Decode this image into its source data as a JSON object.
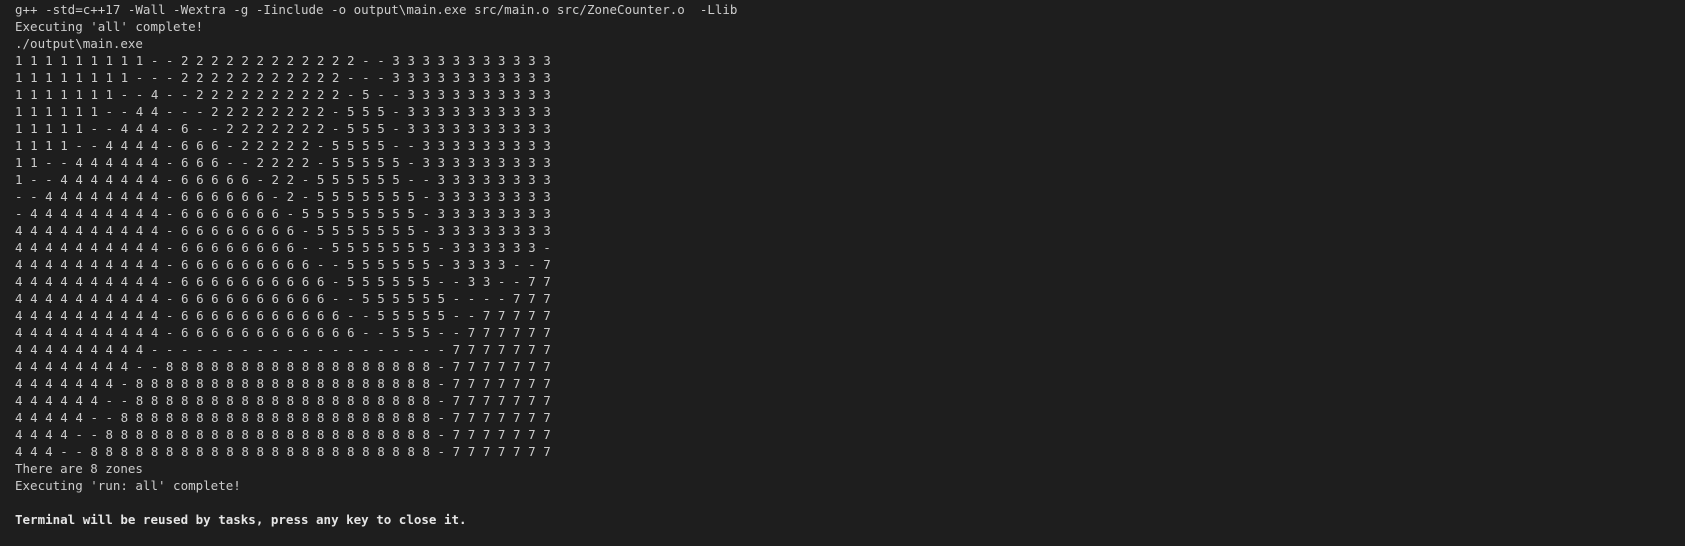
{
  "terminal": {
    "compile_command": "g++ -std=c++17 -Wall -Wextra -g -Iinclude -o output\\main.exe src/main.o src/ZoneCounter.o  -Llib",
    "status_all": "Executing 'all' complete!",
    "run_command": "./output\\main.exe",
    "grid_rows": [
      "1 1 1 1 1 1 1 1 1 - - 2 2 2 2 2 2 2 2 2 2 2 2 - - 3 3 3 3 3 3 3 3 3 3 3",
      "1 1 1 1 1 1 1 1 - - - 2 2 2 2 2 2 2 2 2 2 2 - - - 3 3 3 3 3 3 3 3 3 3 3",
      "1 1 1 1 1 1 1 - - 4 - - 2 2 2 2 2 2 2 2 2 2 - 5 - - 3 3 3 3 3 3 3 3 3 3",
      "1 1 1 1 1 1 - - 4 4 - - - 2 2 2 2 2 2 2 2 - 5 5 5 - 3 3 3 3 3 3 3 3 3 3",
      "1 1 1 1 1 - - 4 4 4 - 6 - - 2 2 2 2 2 2 2 - 5 5 5 - 3 3 3 3 3 3 3 3 3 3",
      "1 1 1 1 - - 4 4 4 4 - 6 6 6 - 2 2 2 2 2 - 5 5 5 5 - - 3 3 3 3 3 3 3 3 3",
      "1 1 - - 4 4 4 4 4 4 - 6 6 6 - - 2 2 2 2 - 5 5 5 5 5 - 3 3 3 3 3 3 3 3 3",
      "1 - - 4 4 4 4 4 4 4 - 6 6 6 6 6 - 2 2 - 5 5 5 5 5 5 - - 3 3 3 3 3 3 3 3",
      "- - 4 4 4 4 4 4 4 4 - 6 6 6 6 6 6 - 2 - 5 5 5 5 5 5 5 - 3 3 3 3 3 3 3 3",
      "- 4 4 4 4 4 4 4 4 4 - 6 6 6 6 6 6 6 - 5 5 5 5 5 5 5 5 - 3 3 3 3 3 3 3 3",
      "4 4 4 4 4 4 4 4 4 4 - 6 6 6 6 6 6 6 6 - 5 5 5 5 5 5 5 - 3 3 3 3 3 3 3 3",
      "4 4 4 4 4 4 4 4 4 4 - 6 6 6 6 6 6 6 6 - - 5 5 5 5 5 5 5 - 3 3 3 3 3 3 -",
      "4 4 4 4 4 4 4 4 4 4 - 6 6 6 6 6 6 6 6 6 - - 5 5 5 5 5 5 - 3 3 3 3 - - 7",
      "4 4 4 4 4 4 4 4 4 4 - 6 6 6 6 6 6 6 6 6 6 - 5 5 5 5 5 5 - - 3 3 - - 7 7",
      "4 4 4 4 4 4 4 4 4 4 - 6 6 6 6 6 6 6 6 6 6 - - 5 5 5 5 5 5 - - - - 7 7 7",
      "4 4 4 4 4 4 4 4 4 4 - 6 6 6 6 6 6 6 6 6 6 6 - - 5 5 5 5 5 - - 7 7 7 7 7",
      "4 4 4 4 4 4 4 4 4 4 - 6 6 6 6 6 6 6 6 6 6 6 6 - - 5 5 5 - - 7 7 7 7 7 7",
      "4 4 4 4 4 4 4 4 4 - - - - - - - - - - - - - - - - - - - - 7 7 7 7 7 7 7",
      "4 4 4 4 4 4 4 4 - - 8 8 8 8 8 8 8 8 8 8 8 8 8 8 8 8 8 8 - 7 7 7 7 7 7 7",
      "4 4 4 4 4 4 4 - 8 8 8 8 8 8 8 8 8 8 8 8 8 8 8 8 8 8 8 8 - 7 7 7 7 7 7 7",
      "4 4 4 4 4 4 - - 8 8 8 8 8 8 8 8 8 8 8 8 8 8 8 8 8 8 8 8 - 7 7 7 7 7 7 7",
      "4 4 4 4 4 - - 8 8 8 8 8 8 8 8 8 8 8 8 8 8 8 8 8 8 8 8 8 - 7 7 7 7 7 7 7",
      "4 4 4 4 - - 8 8 8 8 8 8 8 8 8 8 8 8 8 8 8 8 8 8 8 8 8 8 - 7 7 7 7 7 7 7",
      "4 4 4 - - 8 8 8 8 8 8 8 8 8 8 8 8 8 8 8 8 8 8 8 8 8 8 8 - 7 7 7 7 7 7 7"
    ],
    "zone_count_message": "There are 8 zones",
    "status_run_all": "Executing 'run: all' complete!",
    "reuse_notice": "Terminal will be reused by tasks, press any key to close it."
  }
}
